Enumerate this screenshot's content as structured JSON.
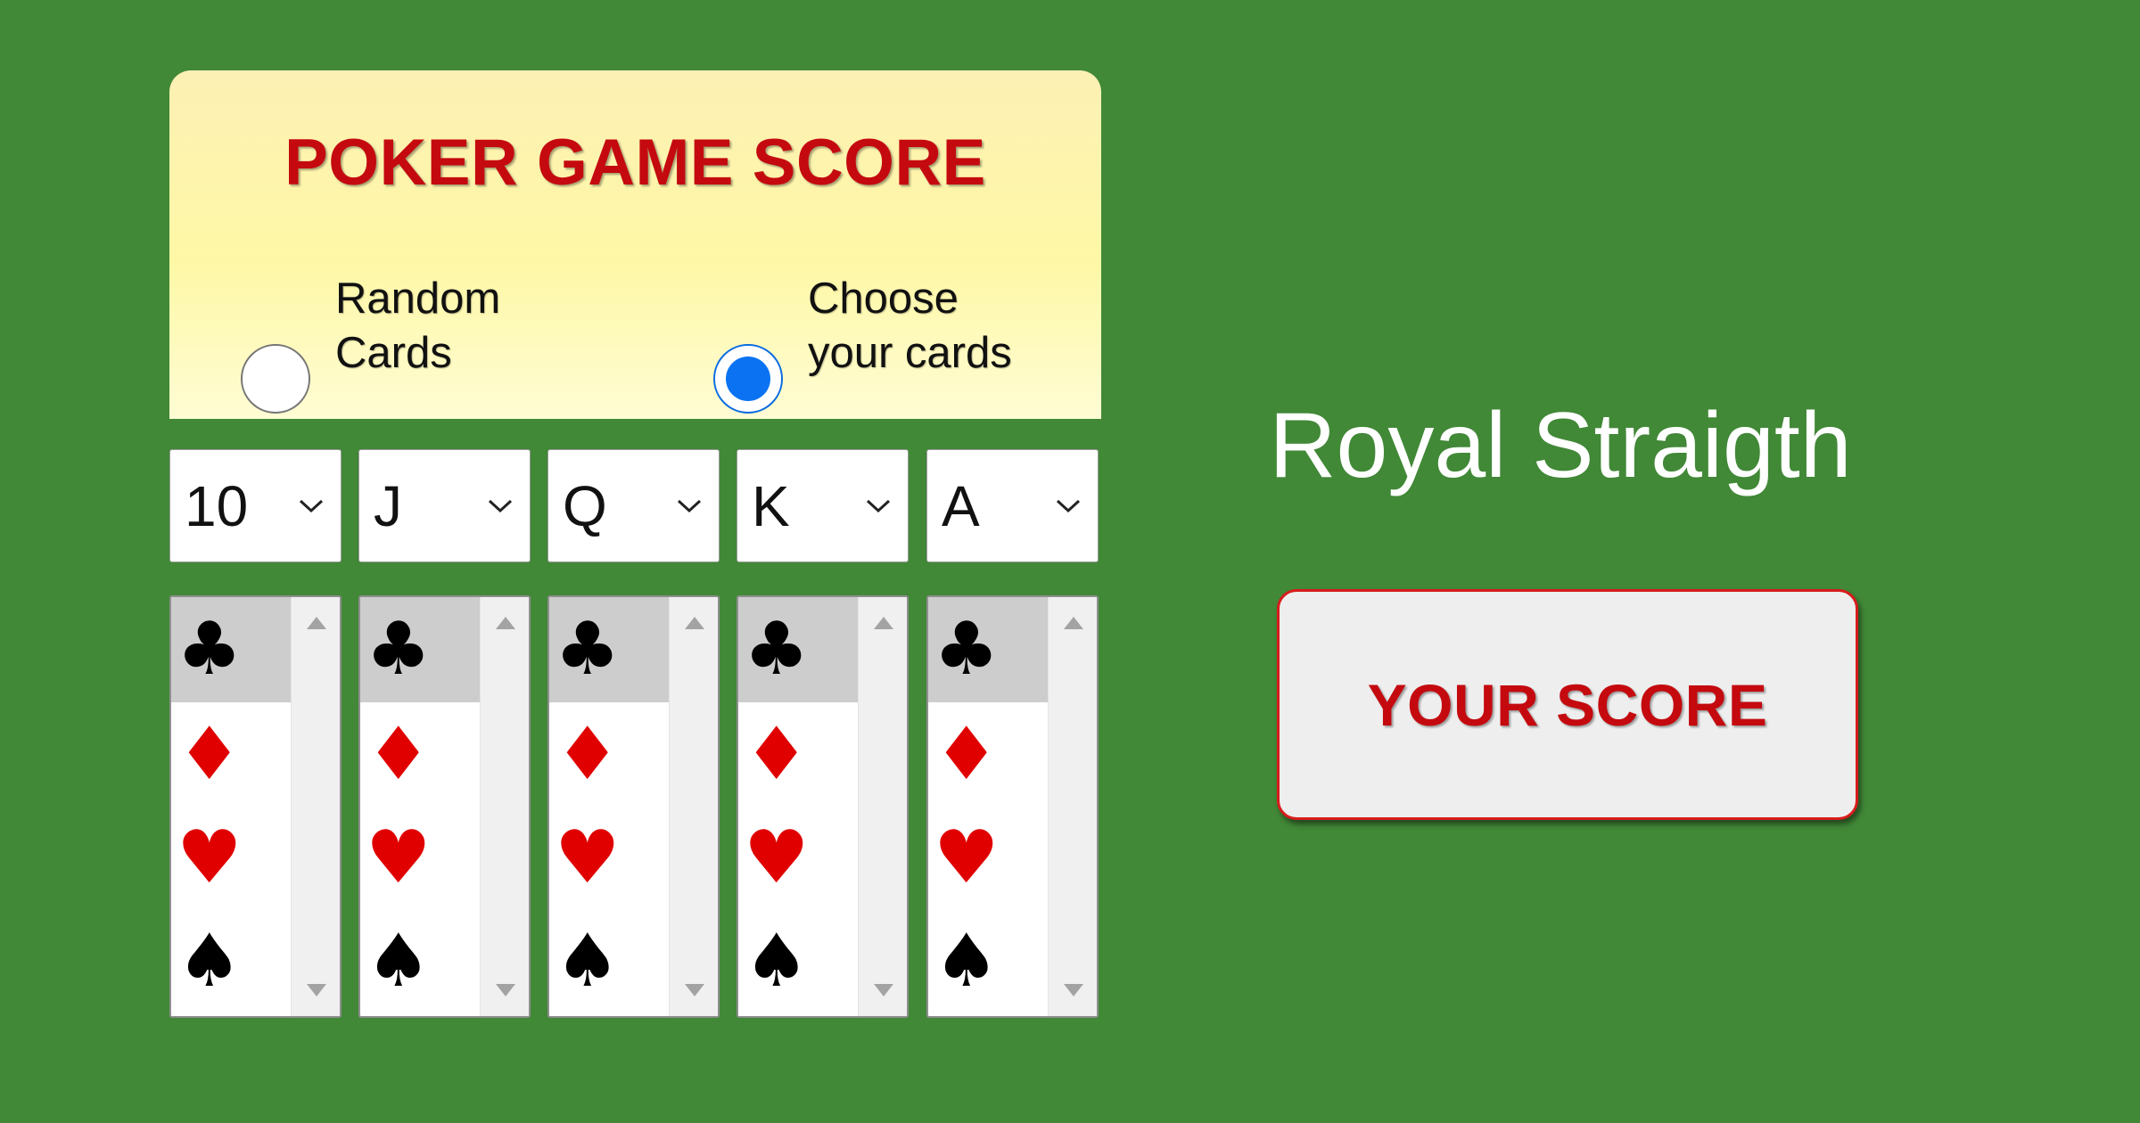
{
  "header": {
    "title": "POKER GAME SCORE"
  },
  "mode": {
    "options": [
      {
        "line1": "Random",
        "line2": "Cards",
        "checked": false
      },
      {
        "line1": "Choose",
        "line2": "your cards",
        "checked": true
      }
    ]
  },
  "cards": [
    {
      "rank": "10"
    },
    {
      "rank": "J"
    },
    {
      "rank": "Q"
    },
    {
      "rank": "K"
    },
    {
      "rank": "A"
    }
  ],
  "suits": {
    "clubs": "♣",
    "diamonds": "♦",
    "hearts": "♥",
    "spades": "♠",
    "selected": "clubs"
  },
  "result": {
    "hand": "Royal Straigth"
  },
  "score_button": {
    "label": "YOUR SCORE"
  },
  "colors": {
    "background": "#418837",
    "title_red": "#c40a0f",
    "radio_blue": "#0b73f2",
    "suit_red": "#e00000"
  }
}
